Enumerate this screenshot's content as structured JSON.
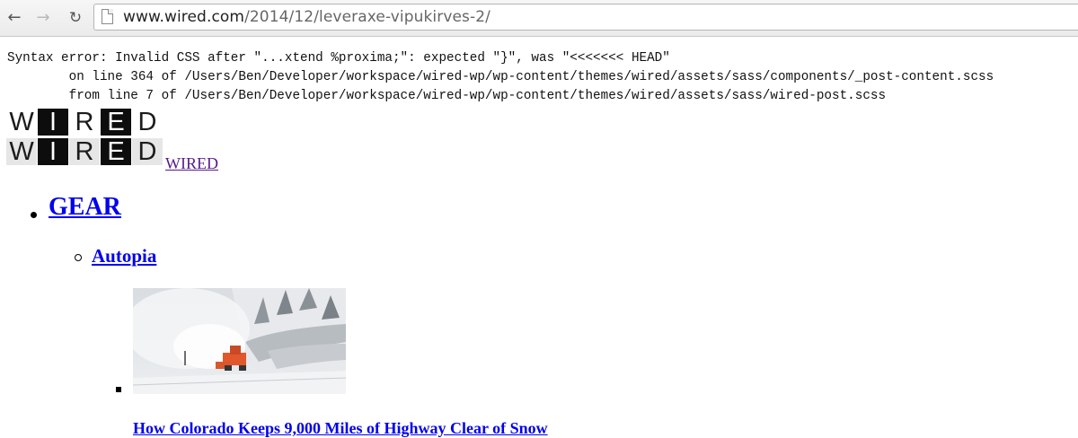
{
  "browser": {
    "nav_back_icon": "arrow-left",
    "nav_forward_icon": "arrow-right",
    "reload_icon": "reload",
    "url_host": "www.wired.com",
    "url_path": "/2014/12/leveraxe-vipukirves-2/"
  },
  "error": {
    "line1": "Syntax error: Invalid CSS after \"...xtend %proxima;\": expected \"}\", was \"<<<<<<< HEAD\"",
    "line2": "        on line 364 of /Users/Ben/Developer/workspace/wired-wp/wp-content/themes/wired/assets/sass/components/_post-content.scss",
    "line3": "        from line 7 of /Users/Ben/Developer/workspace/wired-wp/wp-content/themes/wired/assets/sass/wired-post.scss"
  },
  "logo": {
    "letters": [
      "W",
      "I",
      "R",
      "E",
      "D"
    ],
    "link_text": "WIRED"
  },
  "nav": {
    "section_label": "GEAR",
    "subsection_label": "Autopia"
  },
  "article": {
    "image_alt": "Snowplow clearing a snowy mountain highway",
    "headline": "How Colorado Keeps 9,000 Miles of Highway Clear of Snow"
  },
  "colors": {
    "link_unvisited": "#0000ee",
    "link_visited": "#551a8b",
    "logo_dark": "#0d0d0d",
    "logo_light": "#e6e6e6"
  }
}
